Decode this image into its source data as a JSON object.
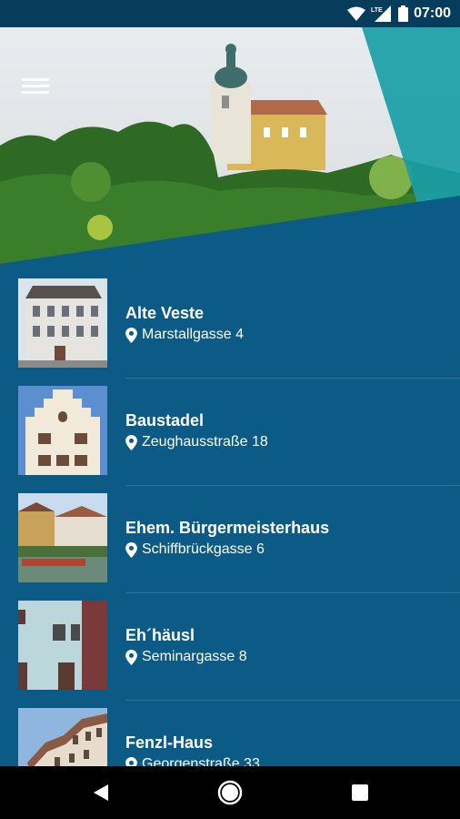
{
  "status_bar": {
    "time": "07:00",
    "network": "LTE",
    "icons": [
      "wifi-icon",
      "lte-signal-icon",
      "battery-icon"
    ]
  },
  "header": {
    "menu_icon": "hamburger-menu-icon",
    "image": "castle-on-hill-banner"
  },
  "colors": {
    "background": "#0b5b86",
    "status_bar": "#063c5c",
    "accent_teal": "#1a9ea6"
  },
  "items": [
    {
      "title": "Alte Veste",
      "address": "Marstallgasse 4"
    },
    {
      "title": "Baustadel",
      "address": "Zeughausstraße 18"
    },
    {
      "title": "Ehem. Bürgermeisterhaus",
      "address": "Schiffbrückgasse 6"
    },
    {
      "title": "Eh´häusl",
      "address": "Seminargasse 8"
    },
    {
      "title": "Fenzl-Haus",
      "address": "Georgenstraße 33"
    }
  ],
  "nav_bar": {
    "buttons": [
      "back-icon",
      "home-icon",
      "recents-icon"
    ]
  }
}
